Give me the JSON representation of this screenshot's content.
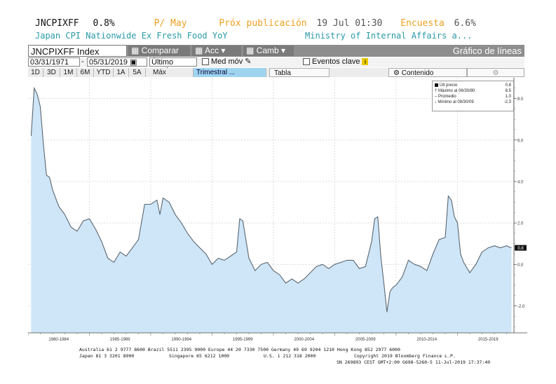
{
  "header": {
    "ticker": "JNCPIXFF",
    "value": "0.8%",
    "period": "P/ May",
    "next_label": "Próx publicación",
    "next_date": "19 Jul 01:30",
    "survey_label": "Encuesta",
    "survey_value": "6.6%",
    "description": "Japan CPI Nationwide Ex Fresh Food YoY",
    "source": "Ministry of Internal Affairs a..."
  },
  "toolbar": {
    "index_label": "JNCPIXFF Index",
    "compare_label": "Comparar",
    "actions_label": "Acc",
    "edit_label": "Camb",
    "chart_title": "Gráfico de líneas"
  },
  "controls": {
    "start_date": "03/31/1971",
    "end_date": "05/31/2019",
    "price_field": "Último preci",
    "moving_avg_label": "Med móv",
    "events_label": "Eventos clave",
    "ranges": [
      "1D",
      "3D",
      "1M",
      "6M",
      "YTD",
      "1A",
      "5A",
      "Máx",
      "Trimestral ..."
    ],
    "table_tab": "Tabla",
    "contents_tab": "Contenido"
  },
  "legend": {
    "rows": [
      {
        "label": "Últ precio",
        "value": "0.8"
      },
      {
        "label": "Máximo al 06/30/80",
        "value": "8.5"
      },
      {
        "label": "Promedio",
        "value": "1.0"
      },
      {
        "label": "Mínimo al 09/30/09",
        "value": "-2.3"
      }
    ]
  },
  "last_value_tag": "0.8",
  "footer": {
    "line1": "Australia 61 2 9777 8600 Brazil 5511 2395 9000 Europe 44 20 7330 7500 Germany 49 69 9204 1210 Hong Kong 852 2977 6000",
    "line2_left": "Japan 81 3 3201 8900",
    "line2_mid": "Singapore 65 6212 1000",
    "line2_us": "U.S. 1 212 318 2000",
    "line2_right": "Copyright 2019 Bloomberg Finance L.P.",
    "line3": "SN 269893 CEST GMT+2:00 G698-5260-5 11-Jul-2019 17:37:40"
  },
  "colors": {
    "area_fill": "#cfe6f8",
    "line": "#5a6670",
    "accent_orange": "#f0a020",
    "accent_teal": "#2a9aa8"
  },
  "chart_data": {
    "type": "area",
    "x_ticks": [
      "1980-1984",
      "1985-1989",
      "1990-1994",
      "1995-1999",
      "2000-2004",
      "2005-2009",
      "2010-2014",
      "2015-2019"
    ],
    "y_ticks": [
      -2.0,
      0.0,
      2.0,
      4.0,
      6.0,
      8.0
    ],
    "ylim": [
      -3.3,
      9.0
    ],
    "xlim": [
      1980.0,
      2019.6
    ],
    "grid": true,
    "legend_position": "top-right",
    "y_axis_side": "right",
    "x": [
      1980.25,
      1980.5,
      1980.75,
      1981.0,
      1981.25,
      1981.5,
      1981.75,
      1982.0,
      1982.5,
      1983.0,
      1983.5,
      1984.0,
      1984.5,
      1985.0,
      1985.5,
      1986.0,
      1986.5,
      1987.0,
      1987.5,
      1988.0,
      1988.5,
      1989.0,
      1989.5,
      1990.0,
      1990.5,
      1990.75,
      1991.0,
      1991.5,
      1992.0,
      1992.5,
      1993.0,
      1993.5,
      1994.0,
      1994.5,
      1995.0,
      1995.5,
      1996.0,
      1996.5,
      1997.0,
      1997.25,
      1997.5,
      1998.0,
      1998.5,
      1999.0,
      1999.5,
      2000.0,
      2000.5,
      2001.0,
      2001.5,
      2002.0,
      2002.5,
      2003.0,
      2003.5,
      2004.0,
      2004.5,
      2005.0,
      2005.5,
      2006.0,
      2006.5,
      2007.0,
      2007.5,
      2008.0,
      2008.25,
      2008.5,
      2008.75,
      2009.0,
      2009.25,
      2009.5,
      2009.75,
      2010.0,
      2010.5,
      2011.0,
      2011.5,
      2012.0,
      2012.5,
      2013.0,
      2013.5,
      2014.0,
      2014.25,
      2014.5,
      2014.75,
      2015.0,
      2015.25,
      2015.5,
      2016.0,
      2016.5,
      2017.0,
      2017.5,
      2018.0,
      2018.5,
      2019.0,
      2019.4
    ],
    "values": [
      6.2,
      8.5,
      8.2,
      7.6,
      5.8,
      4.3,
      4.2,
      3.6,
      2.8,
      2.4,
      1.8,
      1.6,
      2.1,
      2.2,
      1.7,
      1.1,
      0.3,
      0.1,
      0.6,
      0.4,
      0.8,
      1.2,
      2.9,
      2.9,
      3.1,
      2.4,
      3.2,
      3.0,
      2.4,
      2.0,
      1.5,
      1.1,
      0.8,
      0.5,
      0.0,
      0.3,
      0.2,
      0.4,
      0.6,
      2.2,
      2.1,
      0.3,
      -0.3,
      0.0,
      0.1,
      -0.3,
      -0.5,
      -0.9,
      -0.7,
      -0.9,
      -0.7,
      -0.4,
      -0.1,
      0.0,
      -0.2,
      0.0,
      0.1,
      0.2,
      0.2,
      -0.2,
      -0.1,
      1.1,
      2.2,
      2.3,
      0.4,
      -0.9,
      -2.3,
      -1.3,
      -1.1,
      -1.0,
      -0.6,
      0.2,
      0.0,
      -0.1,
      -0.3,
      0.5,
      1.2,
      1.3,
      3.3,
      3.1,
      2.3,
      2.0,
      0.5,
      0.1,
      -0.4,
      0.0,
      0.6,
      0.8,
      0.9,
      0.8,
      0.9,
      0.8
    ]
  }
}
